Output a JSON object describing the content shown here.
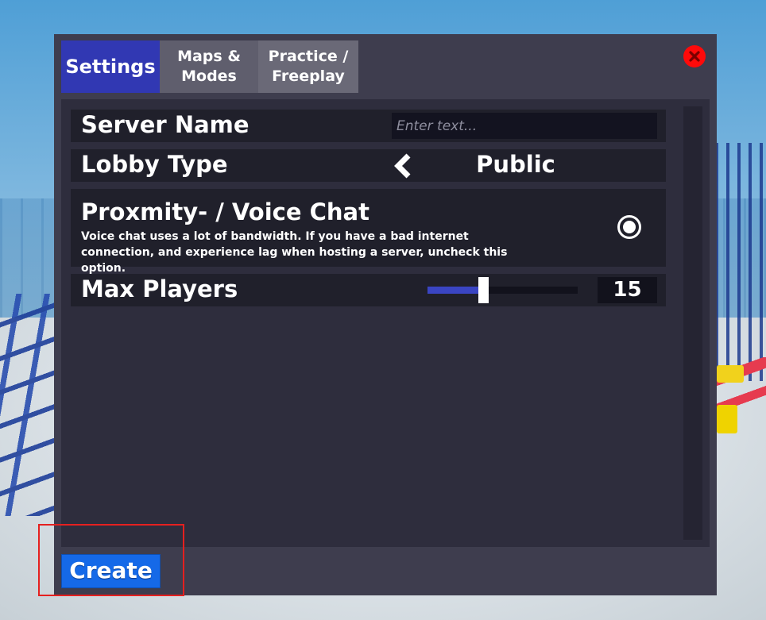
{
  "tabs": [
    {
      "label": "Settings",
      "active": true
    },
    {
      "label": "Maps &\nModes",
      "active": false
    },
    {
      "label": "Practice /\nFreeplay",
      "active": false
    }
  ],
  "close_icon": "close-x-icon",
  "settings": {
    "server_name": {
      "label": "Server Name",
      "value": "",
      "placeholder": "Enter text..."
    },
    "lobby_type": {
      "label": "Lobby Type",
      "value": "Public"
    },
    "voice_chat": {
      "title": "Proxmity- / Voice Chat",
      "description": "Voice chat uses a lot of bandwidth. If you have a bad internet connection, and experience lag when hosting a server, uncheck this option.",
      "checked": true
    },
    "max_players": {
      "label": "Max Players",
      "value": "15",
      "slider_fraction": 0.37
    }
  },
  "create_label": "Create",
  "colors": {
    "accent": "#3138b3",
    "button": "#1569e8",
    "close": "#ff0a0a",
    "highlight": "#e5201f"
  }
}
